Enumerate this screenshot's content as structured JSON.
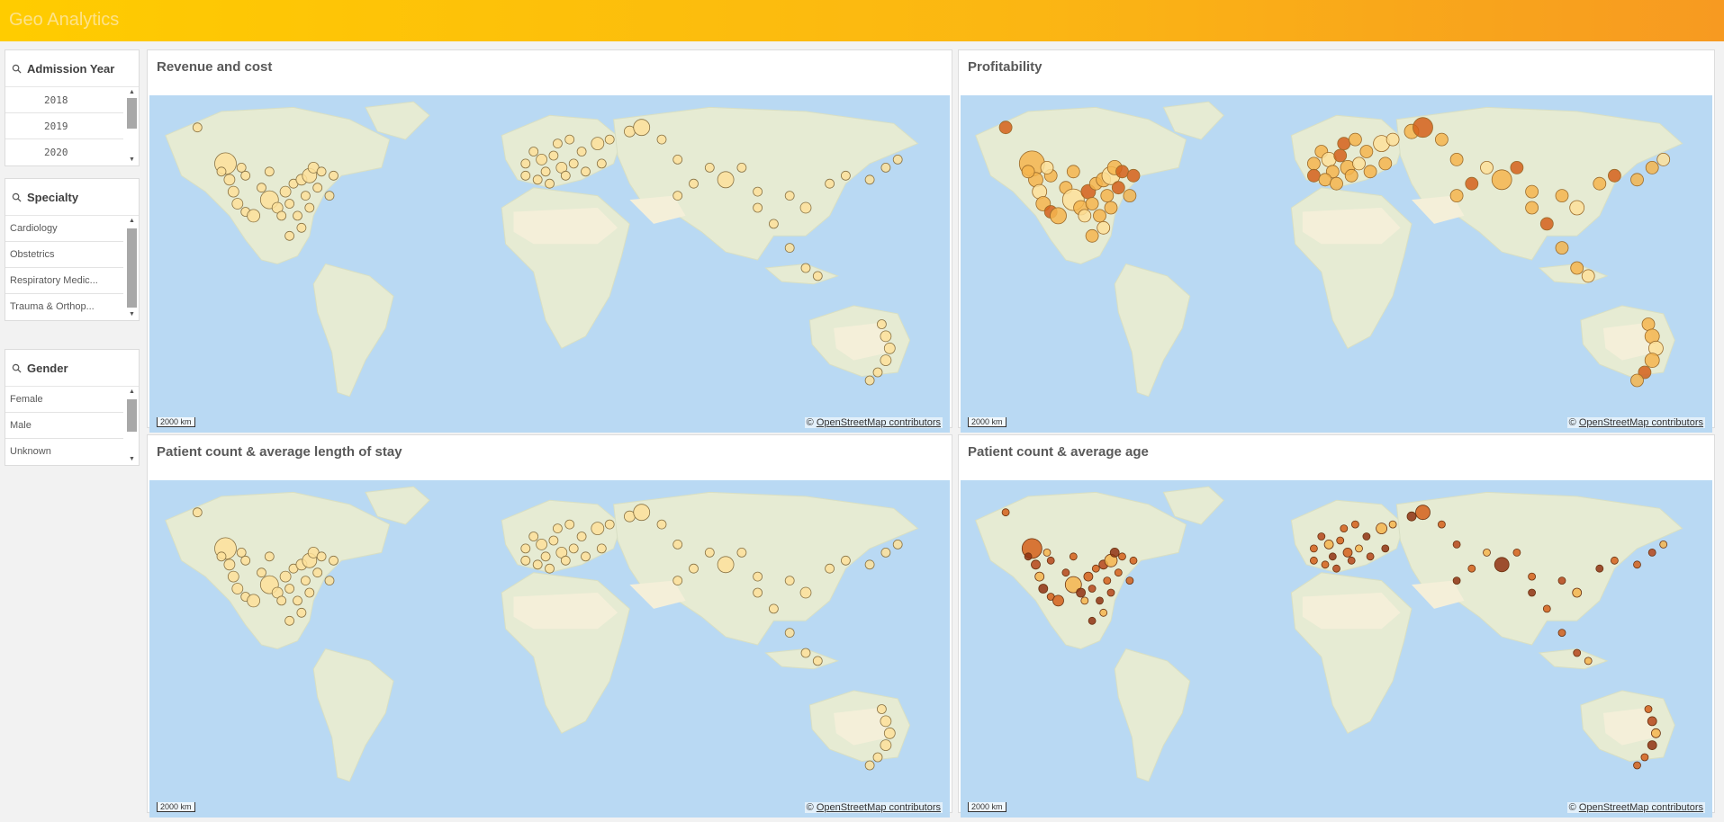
{
  "app": {
    "title": "Geo Analytics"
  },
  "filters": [
    {
      "title": "Admission Year",
      "items": [
        "2018",
        "2019",
        "2020"
      ]
    },
    {
      "title": "Specialty",
      "items": [
        "Cardiology",
        "Obstetrics",
        "Respiratory Medic...",
        "Trauma & Orthop..."
      ]
    },
    {
      "title": "Gender",
      "items": [
        "Female",
        "Male",
        "Unknown"
      ]
    }
  ],
  "panels": [
    {
      "title": "Revenue and cost",
      "scale": "2000 km",
      "attribution_prefix": "©",
      "attribution_link": "OpenStreetMap contributors",
      "palette": "light"
    },
    {
      "title": "Profitability",
      "scale": "2000 km",
      "attribution_prefix": "©",
      "attribution_link": "OpenStreetMap contributors",
      "palette": "mixed"
    },
    {
      "title": "Patient count & average length of stay",
      "scale": "2000 km",
      "attribution_prefix": "©",
      "attribution_link": "OpenStreetMap contributors",
      "palette": "light"
    },
    {
      "title": "Patient count & average age",
      "scale": "2000 km",
      "attribution_prefix": "©",
      "attribution_link": "OpenStreetMap contributors",
      "palette": "dark"
    }
  ],
  "colors": {
    "ocean": "#b9d9f3",
    "land": "#e6ebd3",
    "desert": "#f4efd9",
    "accent_start": "#ffcc00",
    "accent_end": "#f79a21",
    "bubble_light": "#fde09a",
    "bubble_mid": "#f5b54d",
    "bubble_dark": "#d3601a"
  }
}
